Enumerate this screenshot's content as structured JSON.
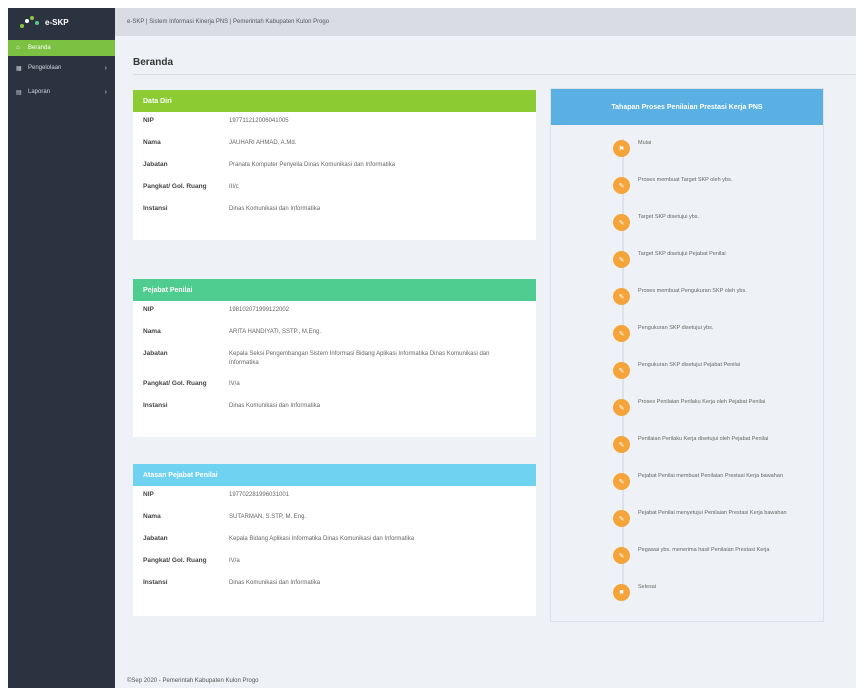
{
  "app": {
    "logo_text": "e-SKP",
    "header_title": "e-SKP | Sistem Informasi Kinerja PNS | Pemerintah Kabupaten Kulon Progo",
    "page_title": "Beranda",
    "footer": "©Sep 2020 - Pemerintah Kabupaten Kulon Progo"
  },
  "sidebar": {
    "items": [
      {
        "label": "Beranda",
        "icon": "home-icon"
      },
      {
        "label": "Pengelolaan",
        "icon": "grid-icon"
      },
      {
        "label": "Laporan",
        "icon": "document-icon"
      }
    ]
  },
  "labels": {
    "nip": "NIP",
    "nama": "Nama",
    "jabatan": "Jabatan",
    "pangkat": "Pangkat/ Gol. Ruang",
    "instansi": "Instansi"
  },
  "data_diri": {
    "title": "Data Diri",
    "nip": "197711212006041005",
    "nama": "JAUHARI AHMAD, A.Md.",
    "jabatan": "Pranata Komputer Penyelia Dinas Komunikasi dan Informatika",
    "pangkat": "III/c",
    "instansi": "Dinas Komunikasi dan Informatika"
  },
  "pejabat_penilai": {
    "title": "Pejabat Penilai",
    "nip": "198102071999122002",
    "nama": "ARITA HANDIYATI, SSTP., M.Eng.",
    "jabatan": "Kepala Seksi Pengembangan Sistem Informasi Bidang Aplikasi Informatika Dinas Komunikasi dan Informatika",
    "pangkat": "IV/a",
    "instansi": "Dinas Komunikasi dan Informatika"
  },
  "atasan_pejabat_penilai": {
    "title": "Atasan Pejabat Penilai",
    "nip": "197702281996031001",
    "nama": "SUTARMAN, S.STP, M. Eng.",
    "jabatan": "Kepala Bidang Aplikasi Informatika Dinas Komunikasi dan Informatika",
    "pangkat": "IV/a",
    "instansi": "Dinas Komunikasi dan Informatika"
  },
  "tahapan": {
    "title": "Tahapan Proses Penilaian Prestasi Kerja PNS",
    "steps": [
      {
        "label": "Mulai",
        "icon": "flag-icon"
      },
      {
        "label": "Proses membuat Target SKP oleh ybs.",
        "icon": "edit-icon"
      },
      {
        "label": "Target SKP disetujui ybs.",
        "icon": "edit-icon"
      },
      {
        "label": "Target SKP disetujui Pejabat Penilai",
        "icon": "edit-icon"
      },
      {
        "label": "Proses membuat Pengukuran SKP oleh ybs.",
        "icon": "edit-icon"
      },
      {
        "label": "Pengukuran SKP disetujui ybs.",
        "icon": "edit-icon"
      },
      {
        "label": "Pengukuran SKP disetujui Pejabat Penilai",
        "icon": "edit-icon"
      },
      {
        "label": "Proses Penilaian Perilaku Kerja oleh Pejabat Penilai",
        "icon": "edit-icon"
      },
      {
        "label": "Penilaian Perilaku Kerja disetujui oleh Pejabat Penilai",
        "icon": "edit-icon"
      },
      {
        "label": "Pejabat Penilai membuat Penilaian Prestasi Kerja bawahan",
        "icon": "edit-icon"
      },
      {
        "label": "Pejabat Penilai menyetujui Penilaian Prestasi Kerja bawahan",
        "icon": "edit-icon"
      },
      {
        "label": "Pegawai ybs. menerima hasil Penilaian Prestasi Kerja",
        "icon": "edit-icon"
      },
      {
        "label": "Selesai",
        "icon": "stop-icon"
      }
    ]
  },
  "colors": {
    "sidebar": "#2b3340",
    "active": "#7dc143",
    "data_diri": "#8ccc32",
    "pejabat_penilai": "#4fcc8f",
    "atasan": "#6fd2f0",
    "tahapan": "#5ab0e3",
    "step": "#f5a43a"
  }
}
